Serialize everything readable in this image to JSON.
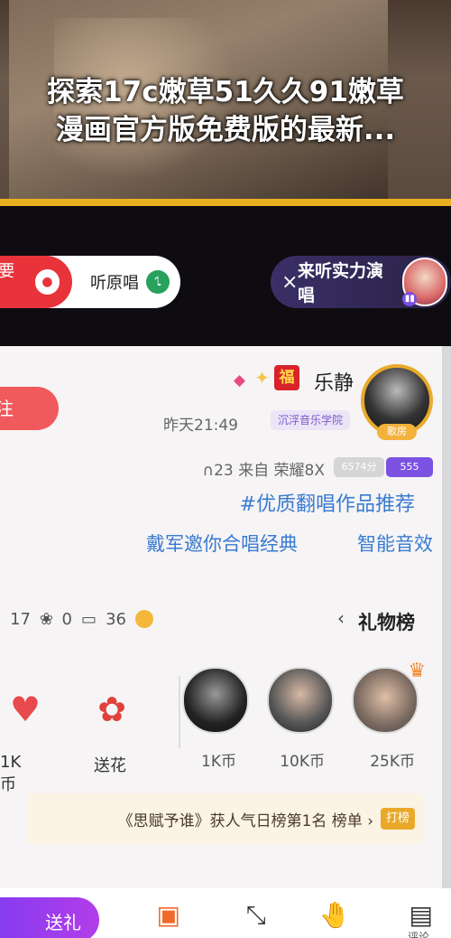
{
  "banner": {
    "caption_line1": "探索17c嫩草51久久91嫩草",
    "caption_line2": "漫画官方版免费版的最新..."
  },
  "topbar": {
    "live_pill_text": "来听实力演唱",
    "close_symbol": "×",
    "listen_text": "听原唱",
    "sing_text": "我要唱"
  },
  "profile": {
    "avatar_tag": "歌房",
    "name": "乐静",
    "fu_char": "福",
    "school_badge": "沉浮音乐学院",
    "time": "昨天21:49",
    "follow_label": "关注",
    "level_badge": "555",
    "fans_badge": "6574分",
    "device": "∩23 来自 荣耀8X",
    "topic": "#优质翻唱作品推荐",
    "tag_effect": "智能音效",
    "tag_duet": "戴军邀你合唱经典"
  },
  "gifts": {
    "title": "礼物榜",
    "chevron": "›",
    "stat_coin": "36",
    "stat_box": "0",
    "stat_flower": "17",
    "ranks": [
      {
        "amount": "25K币"
      },
      {
        "amount": "10K币"
      },
      {
        "amount": "1K币"
      }
    ],
    "send_flower_label": "送花",
    "heart_label": "1K币"
  },
  "notice": {
    "label": "打榜",
    "text": "《思赋予谁》获人气日榜第1名 榜单 ›"
  },
  "bottom": {
    "comment_label": "评论",
    "share_label": "点赞",
    "fullscreen_label": "全屏",
    "gift_label": "礼物",
    "send_label": "送礼"
  }
}
